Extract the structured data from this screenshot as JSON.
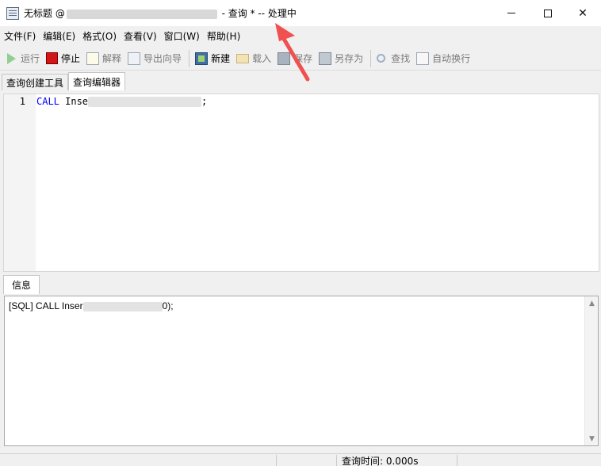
{
  "window": {
    "title_prefix": "无标题 @",
    "title_suffix": "- 查询 * -- 处理中"
  },
  "menu": [
    "文件(F)",
    "编辑(E)",
    "格式(O)",
    "查看(V)",
    "窗口(W)",
    "帮助(H)"
  ],
  "toolbar": {
    "run": "运行",
    "stop": "停止",
    "explain": "解释",
    "export": "导出向导",
    "new": "新建",
    "load": "载入",
    "save": "保存",
    "saveas": "另存为",
    "find": "查找",
    "autowrap": "自动换行"
  },
  "tabs": {
    "builder": "查询创建工具",
    "editor": "查询编辑器"
  },
  "editor": {
    "line_number": "1",
    "keyword": "CALL",
    "text_start": " Inse",
    "text_end": ";"
  },
  "info": {
    "tab": "信息",
    "text_start": "[SQL] CALL Inser",
    "text_end": "0);"
  },
  "status": {
    "query_time": "查询时间: 0.000s"
  },
  "colors": {
    "arrow": "#f05050",
    "keyword": "#0000ff"
  }
}
